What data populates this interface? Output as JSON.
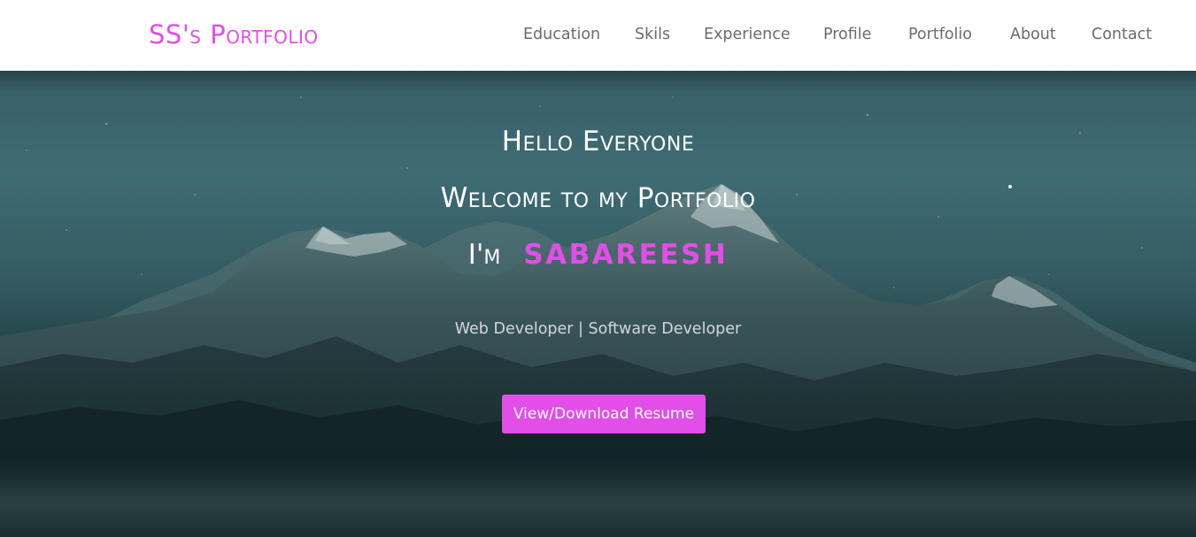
{
  "brand": {
    "label": "SS's Portfolio"
  },
  "nav": {
    "items": [
      {
        "label": "Education"
      },
      {
        "label": "Skils"
      },
      {
        "label": "Experience"
      },
      {
        "label": "Profile"
      },
      {
        "label": "Portfolio"
      },
      {
        "label": "About"
      },
      {
        "label": "Contact"
      }
    ]
  },
  "hero": {
    "greeting": "Hello Everyone",
    "welcome": "Welcome to my Portfolio",
    "im_prefix": "I'm",
    "name": "SABAREESH",
    "subtitle": "Web Developer | Software Developer",
    "button_label": "View/Download Resume",
    "background_image": "mountain-night-sky"
  },
  "colors": {
    "accent": "#e24ee8",
    "nav_text": "#6b6b6b",
    "hero_text": "#ffffff"
  }
}
